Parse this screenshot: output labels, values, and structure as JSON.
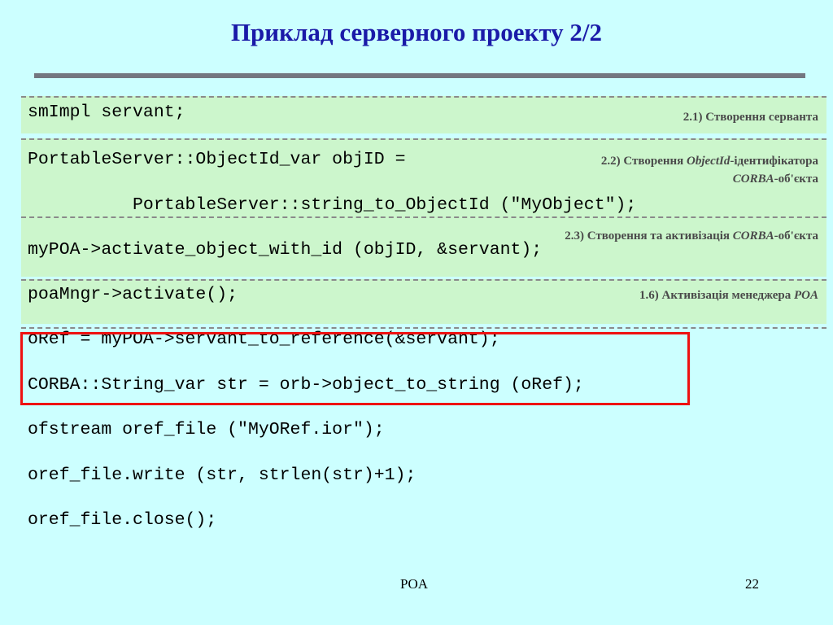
{
  "slide": {
    "title": "Приклад серверного проекту 2/2",
    "footer_center": "POA",
    "page_number": "22"
  },
  "code_lines": [
    "smImpl servant;",
    "PortableServer::ObjectId_var objID =",
    "          PortableServer::string_to_ObjectId (\"MyObject\");",
    "myPOA->activate_object_with_id (objID, &servant);",
    "poaMngr->activate();",
    "oRef = myPOA->servant_to_reference(&servant);",
    "CORBA::String_var str = orb->object_to_string (oRef);",
    "ofstream oref_file (\"MyORef.ior\");",
    "oref_file.write (str, strlen(str)+1);",
    "oref_file.close();"
  ],
  "notes": {
    "n1": "2.1) Створення серванта",
    "n2_prefix": "2.2) Створення ",
    "n2_italic": "ObjectId",
    "n2_suffix": "-ідентифікатора",
    "n2_line2_italic": "CORBA",
    "n2_line2_suffix": "-об'єкта",
    "n3_prefix": "2.3) Створення та активізація ",
    "n3_italic": "CORBA",
    "n3_suffix": "-об'єкта",
    "n4_prefix": "1.6) Активізація менеджера ",
    "n4_italic": "POA"
  },
  "colors": {
    "background": "#ccffff",
    "title": "#1a1aa8",
    "block": "#ccf6cc",
    "highlight": "#ee1111",
    "rule": "#737780"
  }
}
